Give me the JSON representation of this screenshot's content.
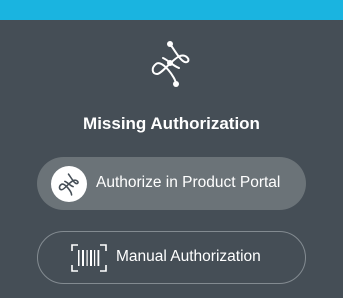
{
  "title": "Missing Authorization",
  "buttons": {
    "portal_label": "Authorize in Product Portal",
    "manual_label": "Manual Authorization"
  },
  "icons": {
    "logo": "portal-logo-icon",
    "portal": "portal-logo-icon",
    "manual": "barcode-scan-icon"
  },
  "colors": {
    "topbar": "#1ab4e0",
    "background": "#454e56",
    "primary_button": "#6b7378",
    "secondary_border": "#838b91"
  }
}
